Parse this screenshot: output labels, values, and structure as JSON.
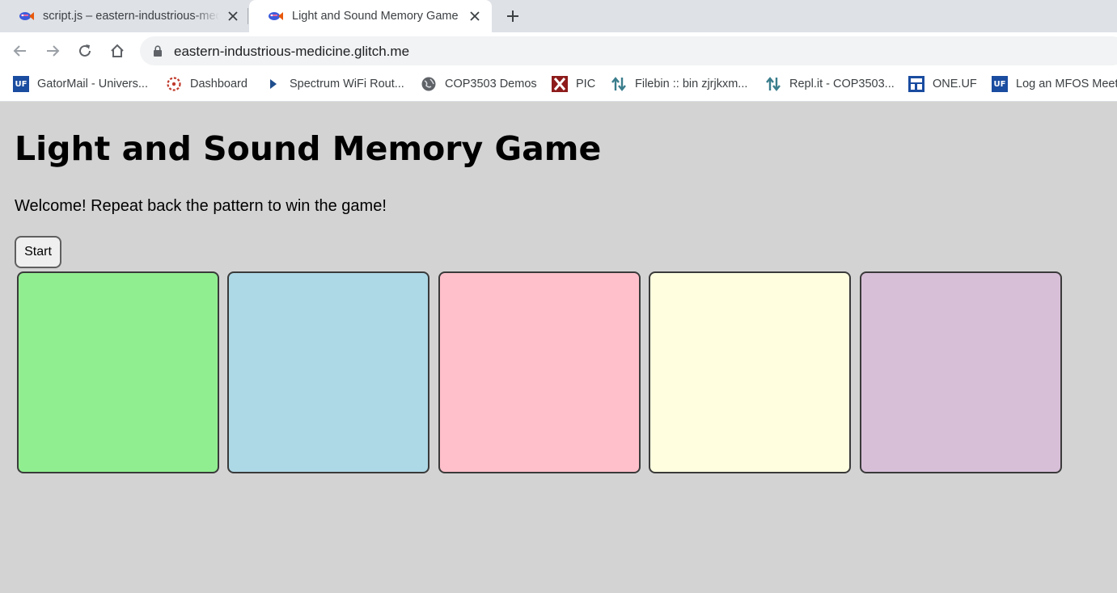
{
  "browser": {
    "tabs": [
      {
        "title": "script.js – eastern-industrious-medicine",
        "active": false
      },
      {
        "title": "Light and Sound Memory Game",
        "active": true
      }
    ],
    "address": "eastern-industrious-medicine.glitch.me",
    "bookmarks": [
      {
        "label": "GatorMail - Univers...",
        "icon": "uf-icon"
      },
      {
        "label": "Dashboard",
        "icon": "canvas-icon"
      },
      {
        "label": "Spectrum WiFi Rout...",
        "icon": "play-triangle-icon"
      },
      {
        "label": "COP3503 Demos",
        "icon": "globe-icon"
      },
      {
        "label": "PIC",
        "icon": "x-logo-icon"
      },
      {
        "label": "Filebin :: bin zjrjkxm...",
        "icon": "updown-arrows-icon"
      },
      {
        "label": "Repl.it - COP3503...",
        "icon": "updown-arrows-icon"
      },
      {
        "label": "ONE.UF",
        "icon": "one-uf-icon"
      },
      {
        "label": "Log an MFOS Meet",
        "icon": "uf-icon"
      }
    ]
  },
  "page": {
    "title": "Light and Sound Memory Game",
    "welcome": "Welcome! Repeat back the pattern to win the game!",
    "start_label": "Start",
    "game_buttons": [
      {
        "color": "#90ee90"
      },
      {
        "color": "#add8e6"
      },
      {
        "color": "#ffc0cb"
      },
      {
        "color": "#ffffe0"
      },
      {
        "color": "#d8bfd8"
      }
    ]
  }
}
